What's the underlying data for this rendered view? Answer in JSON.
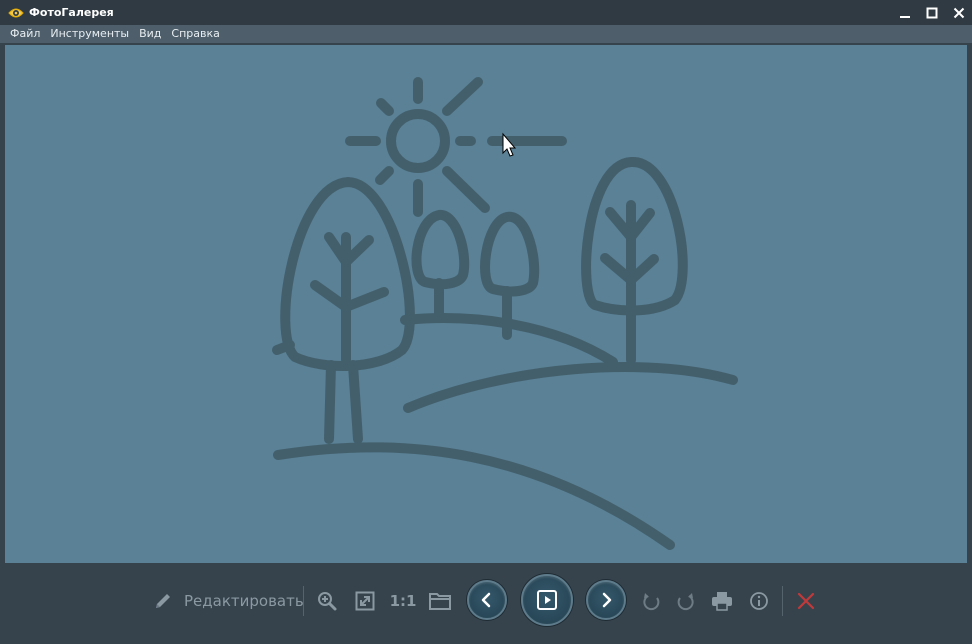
{
  "window": {
    "title": "ФотоГалерея",
    "icon": "eye-icon"
  },
  "menu": {
    "items": [
      "Файл",
      "Инструменты",
      "Вид",
      "Справка"
    ]
  },
  "viewer": {
    "image_subject": "landscape-line-art-icon",
    "background_color": "#5a8195",
    "line_color": "#435f6c"
  },
  "toolbar": {
    "edit_label": "Редактировать",
    "ratio_label": "1:1",
    "icons": [
      "pencil-icon",
      "zoom-in-icon",
      "fit-screen-icon",
      "folder-icon",
      "previous-icon",
      "slideshow-play-icon",
      "next-icon",
      "rotate-left-icon",
      "rotate-right-icon",
      "print-icon",
      "info-icon",
      "delete-icon"
    ],
    "delete_color": "#c0393b"
  }
}
